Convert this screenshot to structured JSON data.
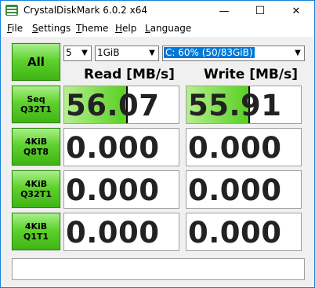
{
  "window": {
    "title": "CrystalDiskMark 6.0.2 x64",
    "minimize_glyph": "—",
    "maximize_glyph": "☐",
    "close_glyph": "✕"
  },
  "menu": [
    "File",
    "Settings",
    "Theme",
    "Help",
    "Language"
  ],
  "controls": {
    "all_label": "All",
    "count_value": "5",
    "size_value": "1GiB",
    "drive_value": "C: 60% (50/83GiB)",
    "dropdown_glyph": "▼"
  },
  "headers": {
    "read": "Read [MB/s]",
    "write": "Write [MB/s]"
  },
  "tests": [
    {
      "line1": "Seq",
      "line2": "Q32T1",
      "read": "56.07",
      "write": "55.91",
      "read_fill": 0.55,
      "write_fill": 0.55
    },
    {
      "line1": "4KiB",
      "line2": "Q8T8",
      "read": "0.000",
      "write": "0.000",
      "read_fill": 0,
      "write_fill": 0
    },
    {
      "line1": "4KiB",
      "line2": "Q32T1",
      "read": "0.000",
      "write": "0.000",
      "read_fill": 0,
      "write_fill": 0
    },
    {
      "line1": "4KiB",
      "line2": "Q1T1",
      "read": "0.000",
      "write": "0.000",
      "read_fill": 0,
      "write_fill": 0
    }
  ],
  "comment": ""
}
